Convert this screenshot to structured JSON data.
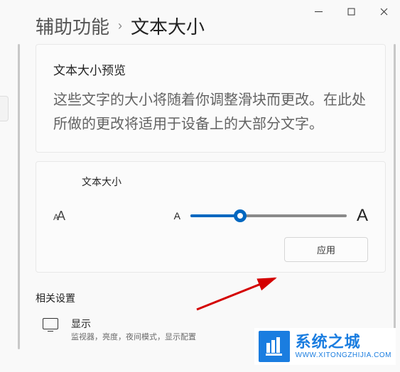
{
  "breadcrumb": {
    "parent": "辅助功能",
    "separator": "›",
    "current": "文本大小"
  },
  "preview": {
    "title": "文本大小预览",
    "body": "这些文字的大小将随着你调整滑块而更改。在此处所做的更改将适用于设备上的大部分文字。"
  },
  "slider": {
    "label": "文本大小",
    "small_marker": "A",
    "large_marker": "A",
    "value_percent": 32,
    "apply_label": "应用"
  },
  "related": {
    "section_title": "相关设置",
    "items": [
      {
        "title": "显示",
        "subtitle": "监视器，亮度，夜间模式，显示配置"
      }
    ]
  },
  "watermark": {
    "brand_cn": "系统之城",
    "brand_url": "WWW.XITONGZHIJIA.COM"
  }
}
